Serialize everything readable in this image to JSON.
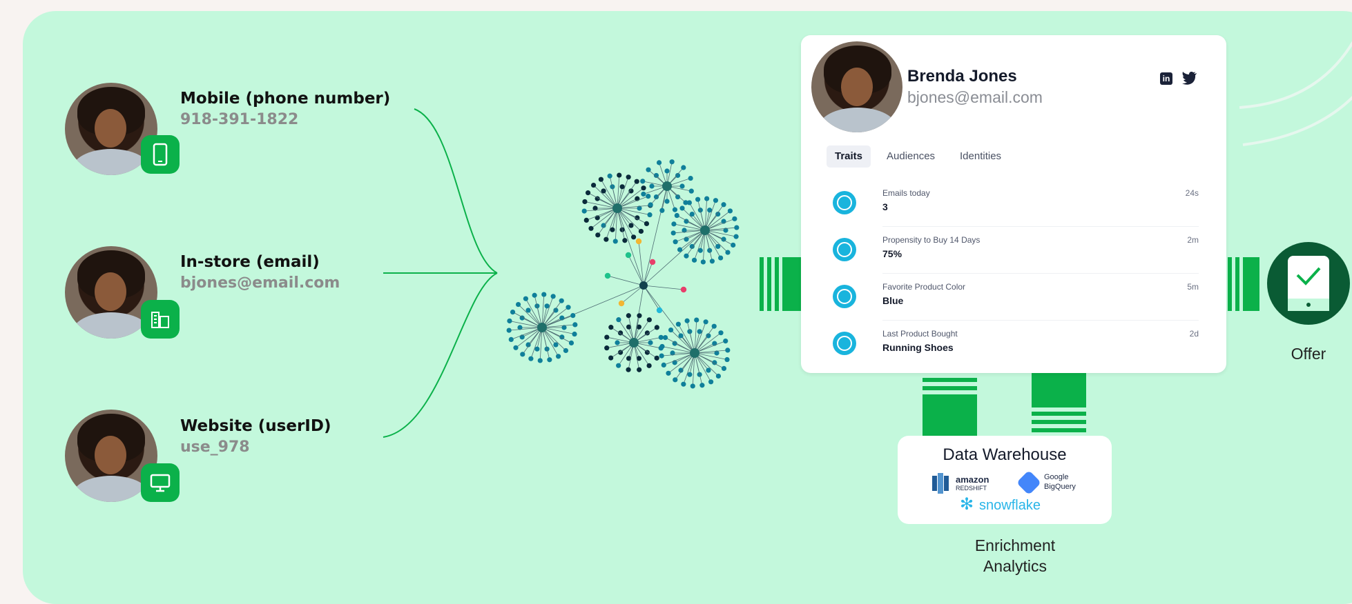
{
  "sources": [
    {
      "title": "Mobile (phone number)",
      "value": "918-391-1822",
      "icon": "phone-icon"
    },
    {
      "title": "In-store (email)",
      "value": "bjones@email.com",
      "icon": "store-icon"
    },
    {
      "title": "Website (userID)",
      "value": "use_978",
      "icon": "monitor-icon"
    }
  ],
  "profile": {
    "name": "Brenda Jones",
    "email": "bjones@email.com",
    "social_icons": [
      "linkedin-icon",
      "twitter-icon"
    ],
    "tabs": [
      {
        "label": "Traits",
        "active": true
      },
      {
        "label": "Audiences",
        "active": false
      },
      {
        "label": "Identities",
        "active": false
      }
    ],
    "traits": [
      {
        "label": "Emails today",
        "value": "3",
        "time": "24s"
      },
      {
        "label": "Propensity to Buy 14 Days",
        "value": "75%",
        "time": "2m"
      },
      {
        "label": "Favorite Product Color",
        "value": "Blue",
        "time": "5m"
      },
      {
        "label": "Last Product Bought",
        "value": "Running Shoes",
        "time": "2d"
      }
    ]
  },
  "warehouse": {
    "title": "Data Warehouse",
    "logos": [
      "amazon",
      "REDSHIFT",
      "Google",
      "BigQuery",
      "snowflake"
    ]
  },
  "labels": {
    "offer": "Offer",
    "enrichment_line1": "Enrichment",
    "enrichment_line2": "Analytics"
  },
  "colors": {
    "panel": "#c3f8dc",
    "green": "#0bb14a",
    "dark_green": "#0a5b34",
    "node_teal": "#0f7f9a",
    "node_dark": "#0a2a3a"
  }
}
